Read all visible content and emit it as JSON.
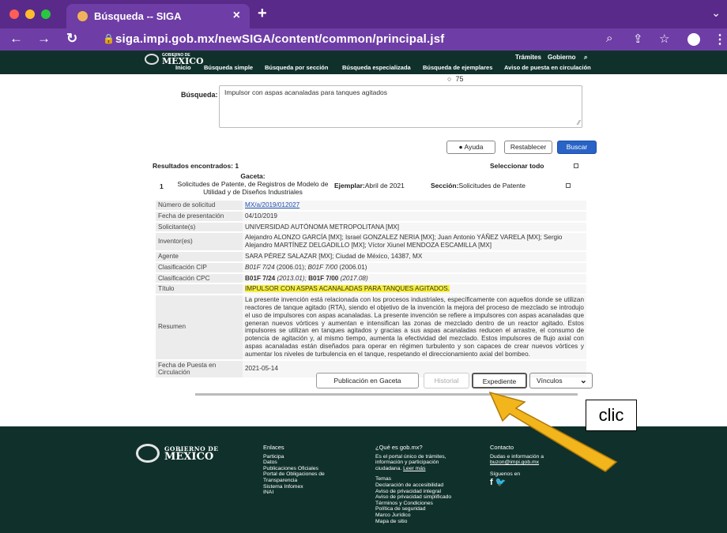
{
  "browser": {
    "tab_title": "Búsqueda -- SIGA",
    "tab_close": "×",
    "new_tab": "+",
    "url": "siga.impi.gob.mx/newSIGA/content/common/principal.jsf",
    "icons": [
      "back-icon",
      "forward-icon",
      "reload-icon",
      "lock-icon",
      "zoom-icon",
      "share-icon",
      "star-icon",
      "profile-icon",
      "kebab-icon"
    ]
  },
  "gov_header": {
    "logo_small": "GOBIERNO DE",
    "logo_big": "MÉXICO",
    "tramites": "Trámites",
    "gobierno": "Gobierno",
    "menu": [
      "Inicio",
      "Búsqueda simple",
      "Búsqueda por sección",
      "Búsqueda especializada",
      "Búsqueda de ejemplares",
      "Aviso de puesta en circulación"
    ]
  },
  "search": {
    "radio_value": "75",
    "label": "Búsqueda:",
    "query": "Impulsor con aspas acanaladas para tanques agitados",
    "help_label": "Ayuda",
    "reset_label": "Restablecer",
    "search_label": "Buscar"
  },
  "results": {
    "count_label": "Resultados encontrados: 1",
    "select_all": "Seleccionar todo",
    "item": {
      "num": "1",
      "gaceta_label": "Gaceta:",
      "gaceta_text": "Solicitudes de Patente, de Registros de Modelo de Utilidad y de Diseños Industriales",
      "ejemplar_label": "Ejemplar:",
      "ejemplar_value": "Abril de 2021",
      "seccion_label": "Sección:",
      "seccion_value": "Solicitudes de Patente"
    },
    "details": {
      "k_numero": "Número de solicitud",
      "v_numero": "MX/a/2019/012027",
      "k_fecha": "Fecha de presentación",
      "v_fecha": "04/10/2019",
      "k_solicitante": "Solicitante(s)",
      "v_solicitante": "UNIVERSIDAD AUTÓNOMA METROPOLITANA [MX]",
      "k_inventor": "Inventor(es)",
      "v_inventor": "Alejandro ALONZO GARCÍA [MX]; Israel GONZALEZ NERIA [MX]; Juan Antonio YÁÑEZ VARELA [MX]; Sergio Alejandro MARTÍNEZ DELGADILLO [MX]; Víctor Xiunel MENDOZA ESCAMILLA [MX]",
      "k_agente": "Agente",
      "v_agente": "SARA PÉREZ SALAZAR [MX]; Ciudad de México, 14387, MX",
      "k_cip": "Clasificación CIP",
      "cip1": "B01F 7/24",
      "cip1d": " (2006.01); ",
      "cip2": "B01F 7/00",
      "cip2d": " (2006.01)",
      "k_cpc": "Clasificación CPC",
      "cpc1": "B01F 7/24",
      "cpc1d": " (2013.01); ",
      "cpc2": "B01F 7/00",
      "cpc2d": " (2017.08)",
      "k_titulo": "Título",
      "v_titulo": "IMPULSOR CON ASPAS ACANALADAS PARA TANQUES AGITADOS.",
      "k_resumen": "Resumen",
      "v_resumen": "La presente invención está relacionada con los procesos industriales, específicamente con aquellos donde se utilizan reactores de tanque agitado (RTA), siendo el objetivo de la invención la mejora del proceso de mezclado se introdujo el uso de impulsores con aspas acanaladas. La presente invención se refiere a impulsores con aspas acanaladas que generan nuevos vórtices y aumentan e intensifican las zonas de mezclado dentro de un reactor agitado. Estos impulsores se utilizan en tanques agitados y gracias a sus aspas acanaladas reducen el arrastre, el consumo de potencia de agitación y, al mismo tiempo, aumenta la efectividad del mezclado. Estos impulsores de flujo axial con aspas acanaladas están diseñados para operar en régimen turbulento y son capaces de crear nuevos vórtices y aumentar los niveles de turbulencia en el tanque, respetando el direccionamiento axial del bombeo.",
      "k_puesta": "Fecha de Puesta en Circulación",
      "v_puesta": "2021-05-14"
    },
    "actions": {
      "publicacion": "Publicación en Gaceta",
      "historial": "Historial",
      "expediente": "Expediente",
      "vinculos": "Vínculos"
    }
  },
  "footer": {
    "logo_small": "GOBIERNO DE",
    "logo_big": "MÉXICO",
    "enlaces_title": "Enlaces",
    "enlaces": [
      "Participa",
      "Datos",
      "Publicaciones Oficiales",
      "Portal de Obligaciones de",
      "Transparencia",
      "Sistema Infomex",
      "INAI"
    ],
    "que_title": "¿Qué es gob.mx?",
    "que_text": [
      "Es el portal único de trámites,",
      "información y participación"
    ],
    "que_last": "ciudadana. ",
    "leer_mas": "Leer más",
    "temas": [
      "Temas",
      "Declaración de accesibilidad",
      "Aviso de privacidad integral",
      "Aviso de privacidad simplificado",
      "Términos y Condiciones",
      "Política de seguridad",
      "Marco Jurídico",
      "Mapa de sitio"
    ],
    "contacto_title": "Contacto",
    "contacto_text": "Dudas e información a",
    "contacto_email": "buzon@impi.gob.mx",
    "siguenos": "Síguenos en",
    "social": "f🐦"
  },
  "annotation": {
    "label": "clic",
    "arrow_color": "#f2b51c"
  }
}
